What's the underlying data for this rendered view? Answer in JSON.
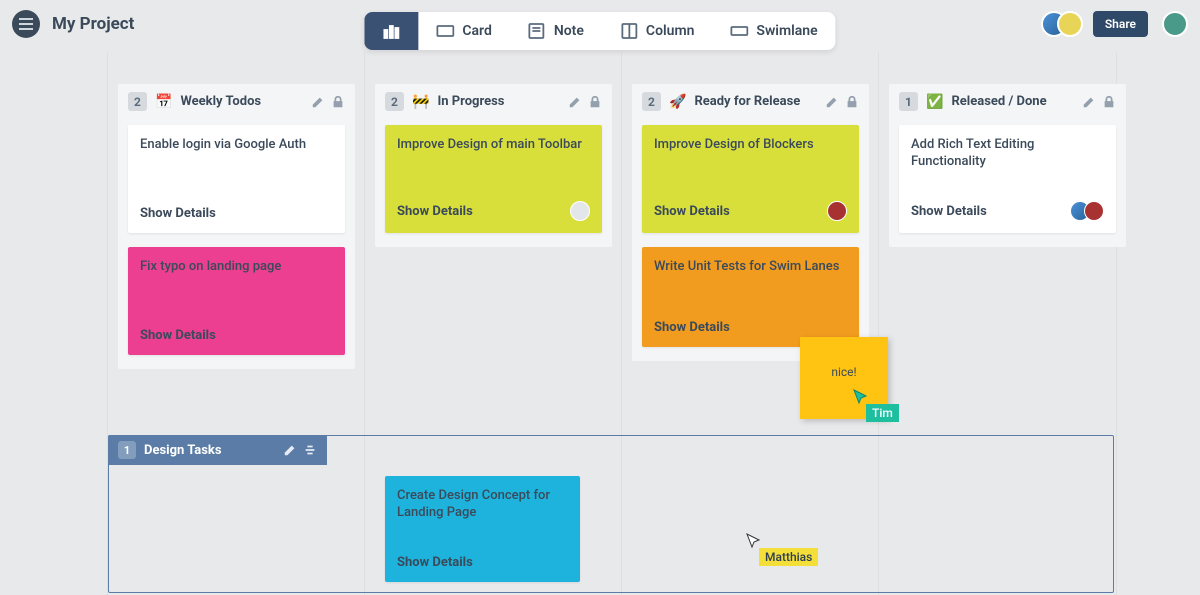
{
  "header": {
    "project_title": "My Project",
    "share_label": "Share"
  },
  "view_tabs": {
    "chart": "",
    "card": "Card",
    "note": "Note",
    "column": "Column",
    "swimlane": "Swimlane"
  },
  "columns": [
    {
      "count": "2",
      "emoji": "📅",
      "title": "Weekly Todos",
      "cards": [
        {
          "title": "Enable login via Google Auth",
          "show": "Show Details",
          "color": "white",
          "avatars": []
        },
        {
          "title": "Fix typo on landing page",
          "show": "Show Details",
          "color": "pink",
          "avatars": []
        }
      ]
    },
    {
      "count": "2",
      "emoji": "🚧",
      "title": "In Progress",
      "cards": [
        {
          "title": "Improve Design of main Toolbar",
          "show": "Show Details",
          "color": "yellowgreen",
          "avatars": [
            "grey"
          ]
        }
      ]
    },
    {
      "count": "2",
      "emoji": "🚀",
      "title": "Ready for Release",
      "cards": [
        {
          "title": "Improve Design of Blockers",
          "show": "Show Details",
          "color": "yellowgreen",
          "avatars": [
            "red"
          ]
        },
        {
          "title": "Write Unit Tests for Swim Lanes",
          "show": "Show Details",
          "color": "orange",
          "avatars": []
        }
      ]
    },
    {
      "count": "1",
      "emoji": "✅",
      "title": "Released / Done",
      "cards": [
        {
          "title": "Add Rich Text Editing Functionality",
          "show": "Show Details",
          "color": "white",
          "avatars": [
            "blue",
            "red"
          ]
        }
      ]
    }
  ],
  "swimlane": {
    "count": "1",
    "title": "Design Tasks",
    "card": {
      "title": "Create Design Concept for Landing Page",
      "show": "Show Details"
    }
  },
  "sticky": {
    "text": "nice!"
  },
  "cursors": {
    "tim": "Tim",
    "matthias": "Matthias"
  }
}
